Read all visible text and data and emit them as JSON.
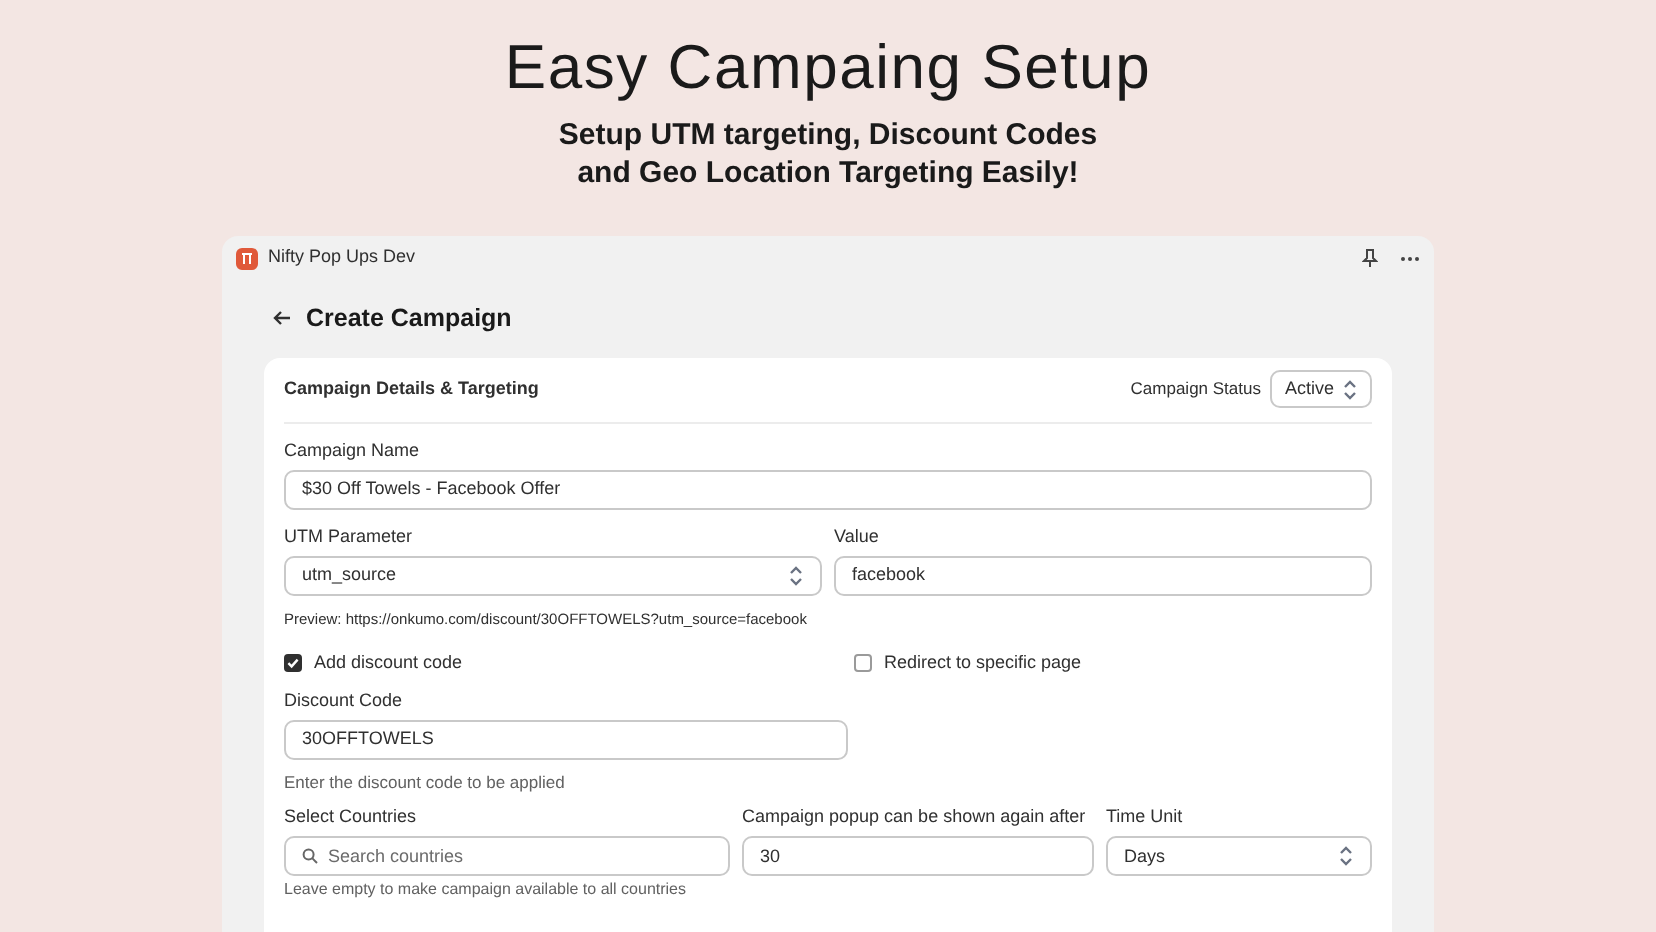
{
  "hero": {
    "title": "Easy Campaing Setup",
    "subtitle_lines": [
      "Setup UTM targeting, Discount Codes",
      "and Geo Location Targeting Easily!"
    ]
  },
  "window": {
    "title": "Nifty Pop Ups Dev"
  },
  "page": {
    "title": "Create Campaign"
  },
  "card": {
    "title": "Campaign Details & Targeting",
    "status_label": "Campaign Status",
    "status_value": "Active"
  },
  "campaign_name": {
    "label": "Campaign Name",
    "value": "$30 Off Towels - Facebook Offer"
  },
  "utm_parameter": {
    "label": "UTM Parameter",
    "value": "utm_source"
  },
  "utm_value": {
    "label": "Value",
    "value": "facebook"
  },
  "preview": "Preview: https://onkumo.com/discount/30OFFTOWELS?utm_source=facebook",
  "checkboxes": [
    {
      "label": "Add discount code",
      "checked": true
    },
    {
      "label": "Redirect to specific page",
      "checked": false
    }
  ],
  "discount_code": {
    "label": "Discount Code",
    "value": "30OFFTOWELS",
    "hint": "Enter the discount code to be applied"
  },
  "countries": {
    "label": "Select Countries",
    "placeholder": "Search countries",
    "hint": "Leave empty to make campaign available to all countries"
  },
  "show_again": {
    "label": "Campaign popup can be shown again after",
    "value": "30"
  },
  "time_unit": {
    "label": "Time Unit",
    "value": "Days"
  }
}
